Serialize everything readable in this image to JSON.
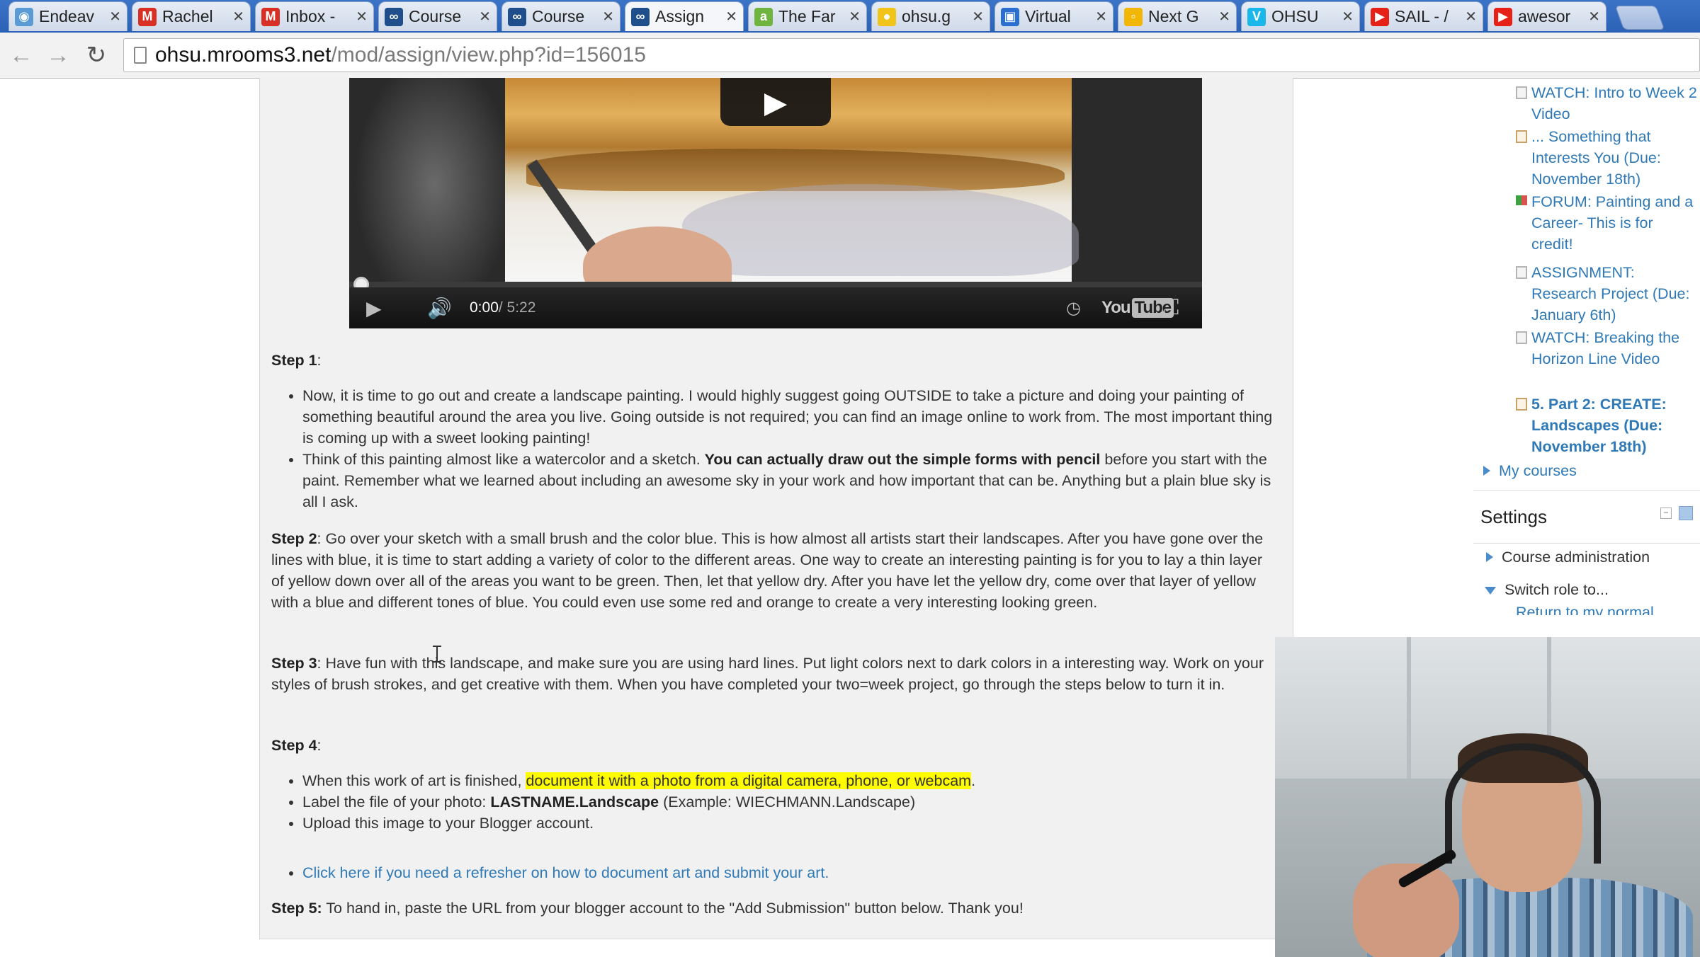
{
  "browser": {
    "tabs": [
      {
        "title": "Endeav",
        "icon": "globe-people-icon",
        "color": "#5a9bd5"
      },
      {
        "title": "Rachel",
        "icon": "gmail-icon",
        "color": "#d93025"
      },
      {
        "title": "Inbox -",
        "icon": "gmail-icon",
        "color": "#d93025"
      },
      {
        "title": "Course",
        "icon": "moodlerooms-icon",
        "color": "#1f4e8c"
      },
      {
        "title": "Course",
        "icon": "moodlerooms-icon",
        "color": "#1f4e8c"
      },
      {
        "title": "Assign",
        "icon": "moodlerooms-icon",
        "color": "#1f4e8c",
        "active": true
      },
      {
        "title": "The Far",
        "icon": "a-icon",
        "color": "#6fb43f"
      },
      {
        "title": "ohsu.g",
        "icon": "lightbulb-icon",
        "color": "#f0c419"
      },
      {
        "title": "Virtual",
        "icon": "chat-icon",
        "color": "#2b6fd1"
      },
      {
        "title": "Next G",
        "icon": "note-icon",
        "color": "#f2b705"
      },
      {
        "title": "OHSU",
        "icon": "vimeo-icon",
        "color": "#19b7ea"
      },
      {
        "title": "SAIL - /",
        "icon": "youtube-icon",
        "color": "#e62117"
      },
      {
        "title": "awesor",
        "icon": "youtube-icon",
        "color": "#e62117"
      }
    ],
    "url_host": "ohsu.mrooms3.net",
    "url_path": "/mod/assign/view.php?id=156015"
  },
  "video": {
    "time_current": "0:00",
    "time_total": " / 5:22",
    "logo": "You",
    "logo_box": "Tube"
  },
  "content": {
    "step1_label": "Step 1",
    "step1_colon": ":",
    "step1_bullet1": "Now, it is time to go out and create a landscape painting. I would highly suggest going OUTSIDE to take a picture and doing your painting of something beautiful around the area you live. Going outside is not required; you can find an image online to work from. The most important thing is coming up with a sweet looking painting!",
    "step1_bullet2_pre": "Think of this painting almost like a watercolor and a sketch. ",
    "step1_bullet2_bold": "You can actually draw out the simple forms with pencil",
    "step1_bullet2_post": " before you start with the paint. Remember what we learned about including an awesome sky in your work and how important that can be. Anything but a plain blue sky is all I ask.",
    "step2_label": "Step 2",
    "step2_text": ": Go over your sketch with a small brush and the color blue. This is how almost all artists start their landscapes. After you have gone over the lines with blue, it is time to start adding a variety of color to the different areas. One way to create an interesting painting is for you to lay a thin layer of yellow down over all of the areas you want to be green. Then, let that yellow dry. After you have let the yellow dry, come over that layer of yellow with a blue and different tones of blue. You could even use some red and orange to create a very interesting looking green.",
    "step3_label": "Step 3",
    "step3_text": ": Have fun with this landscape, and make sure you are using hard lines. Put light colors next to dark colors in a interesting way. Work on your styles of brush strokes, and get creative with them. When you have completed your two=week project, go through the steps below to turn it in.",
    "step4_label": "Step 4",
    "step4_colon": ":",
    "step4_b1_pre": "When this work of art is finished, ",
    "step4_b1_highlight": "document it with a photo from a digital camera, phone, or webcam",
    "step4_b1_post": ".",
    "step4_b2_pre": "Label the file of your photo: ",
    "step4_b2_bold": "LASTNAME.Landscape",
    "step4_b2_post": " (Example: WIECHMANN.Landscape)",
    "step4_b3": "Upload this image to your Blogger account.",
    "step4_link": "Click here if you need a refresher on how to document art and submit your art.",
    "step5_label": "Step 5:",
    "step5_text": " To hand in, paste the URL from your blogger account to the \"Add Submission\" button below. Thank you!"
  },
  "sidebar": {
    "items": [
      {
        "label": "WATCH: Intro to Week 2 Video",
        "icon": "page-icon"
      },
      {
        "label": "... Something that Interests You (Due: November 18th)",
        "icon": "assignment-icon"
      },
      {
        "label": "FORUM: Painting and a Career- This is for credit!",
        "icon": "forum-icon"
      },
      {
        "label": "ASSIGNMENT: Research Project (Due: January 6th)",
        "icon": "page-icon"
      },
      {
        "label": "WATCH: Breaking the Horizon Line Video",
        "icon": "page-icon"
      },
      {
        "label": "5. Part 2: CREATE: Landscapes (Due: November 18th)",
        "icon": "assignment-icon",
        "current": true
      }
    ],
    "my_courses": "My courses",
    "settings_title": "Settings",
    "course_admin": "Course administration",
    "switch_role": "Switch role to...",
    "return_normal": "Return to my normal"
  }
}
